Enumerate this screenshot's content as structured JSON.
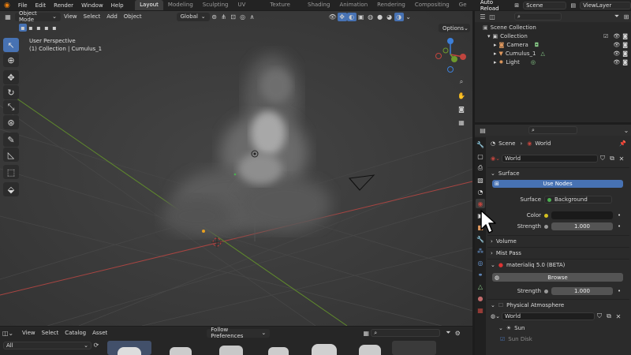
{
  "menu": [
    "File",
    "Edit",
    "Render",
    "Window",
    "Help"
  ],
  "workspaces": [
    {
      "label": "Layout",
      "active": true
    },
    {
      "label": "Modeling"
    },
    {
      "label": "Sculpting"
    },
    {
      "label": "UV Editing"
    },
    {
      "label": "Texture Paint"
    },
    {
      "label": "Shading"
    },
    {
      "label": "Animation"
    },
    {
      "label": "Rendering"
    },
    {
      "label": "Compositing"
    },
    {
      "label": "Ge"
    }
  ],
  "top_right": {
    "auto_reload": "Auto Reload",
    "scene": "Scene",
    "view_layer": "ViewLayer"
  },
  "viewport": {
    "mode": "Object Mode",
    "menus": [
      "View",
      "Select",
      "Add",
      "Object"
    ],
    "transform": "Global",
    "options": "Options",
    "perspective": "User Perspective",
    "collection_info": "(1) Collection | Cumulus_1"
  },
  "outliner": {
    "root": "Scene Collection",
    "collection": "Collection",
    "items": [
      {
        "label": "Camera",
        "icon": "camera-icon",
        "color": "#e0995e"
      },
      {
        "label": "Cumulus_1",
        "icon": "mesh-icon",
        "color": "#e0995e"
      },
      {
        "label": "Light",
        "icon": "light-icon",
        "color": "#e0995e"
      }
    ]
  },
  "properties": {
    "breadcrumb_scene": "Scene",
    "breadcrumb_world": "World",
    "world_name": "World",
    "surface_section": "Surface",
    "use_nodes": "Use Nodes",
    "surface_label": "Surface",
    "surface_value": "Background",
    "color_label": "Color",
    "strength_label": "Strength",
    "strength_value": "1.000",
    "volume": "Volume",
    "mist_pass": "Mist Pass",
    "materialiq": "materialiq 5.0 (BETA)",
    "browse": "Browse",
    "strength2_label": "Strength",
    "strength2_value": "1.000",
    "physical_atmosphere": "Physical Atmosphere",
    "pa_world": "World",
    "sun": "Sun",
    "sun_disk": "Sun Disk"
  },
  "assetbar": {
    "menus": [
      "View",
      "Select",
      "Catalog",
      "Asset"
    ],
    "follow": "Follow Preferences",
    "library": "All"
  },
  "colors": {
    "accent": "#4772b3",
    "x_axis": "#c0453e",
    "y_axis": "#6e9a2c",
    "z_axis": "#3c7fd8"
  }
}
